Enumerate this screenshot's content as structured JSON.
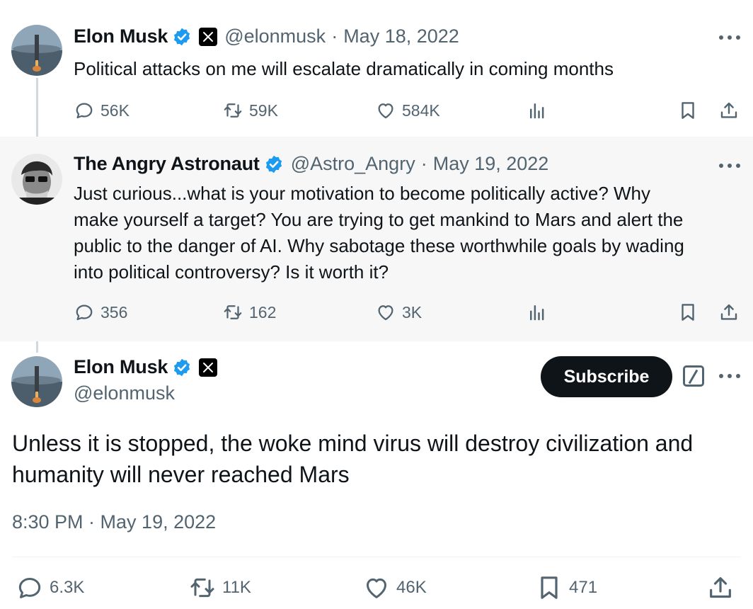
{
  "thread": [
    {
      "display_name": "Elon Musk",
      "handle": "@elonmusk",
      "separator": "·",
      "date": "May 18, 2022",
      "text": "Political attacks on me will escalate dramatically in coming months",
      "replies": "56K",
      "reposts": "59K",
      "likes": "584K"
    },
    {
      "display_name": "The Angry Astronaut",
      "handle": "@Astro_Angry",
      "separator": "·",
      "date": "May 19, 2022",
      "text_lines": [
        "Just curious...what is your motivation to become politically active?  Why",
        "make yourself a target?  You are trying to get mankind to Mars and alert the",
        "public to the danger of AI.  Why sabotage these worthwhile goals by wading",
        "into political controversy?  Is it worth it?"
      ],
      "replies": "356",
      "reposts": "162",
      "likes": "3K"
    }
  ],
  "main_tweet": {
    "display_name": "Elon Musk",
    "handle": "@elonmusk",
    "subscribe_label": "Subscribe",
    "text_lines": [
      "Unless it is stopped, the woke mind virus will destroy civilization and",
      "humanity will never reached Mars"
    ],
    "timestamp": "8:30 PM · May 19, 2022",
    "replies": "6.3K",
    "reposts": "11K",
    "likes": "46K",
    "bookmarks": "471"
  },
  "colors": {
    "verified": "#1d9bf0",
    "text_primary": "#0f1419",
    "text_secondary": "#536471",
    "highlight_bg": "#f7f7f7"
  },
  "icons": [
    "reply-icon",
    "repost-icon",
    "like-icon",
    "views-icon",
    "bookmark-icon",
    "share-icon",
    "verified-badge-icon",
    "x-affiliate-icon",
    "more-icon",
    "grok-icon"
  ]
}
